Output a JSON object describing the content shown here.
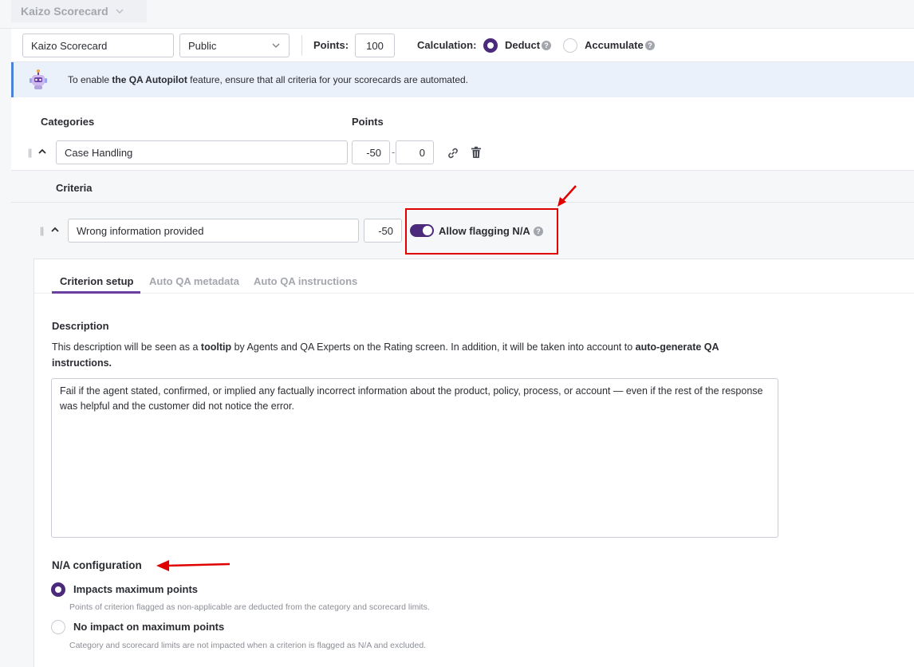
{
  "breadcrumb": {
    "title": "Kaizo Scorecard"
  },
  "settings": {
    "name_value": "Kaizo Scorecard",
    "visibility_value": "Public",
    "points_label": "Points:",
    "points_value": "100",
    "calculation_label": "Calculation:",
    "deduct_label": "Deduct",
    "accumulate_label": "Accumulate",
    "selected_calculation": "Deduct"
  },
  "banner": {
    "text_prefix": "To enable ",
    "text_bold": "the QA Autopilot",
    "text_suffix": " feature, ensure that all criteria for your scorecards are automated."
  },
  "categories": {
    "header_label": "Categories",
    "points_header_label": "Points",
    "items": [
      {
        "name": "Case Handling",
        "min": "-50",
        "separator": "-",
        "max": "0"
      }
    ]
  },
  "criteria": {
    "header_label": "Criteria",
    "items": [
      {
        "name": "Wrong information provided",
        "points": "-50",
        "toggle_label": "Allow flagging N/A",
        "toggle_on": true
      }
    ]
  },
  "tabs": [
    {
      "label": "Criterion setup",
      "active": true
    },
    {
      "label": "Auto QA metadata",
      "active": false
    },
    {
      "label": "Auto QA instructions",
      "active": false
    }
  ],
  "description": {
    "title": "Description",
    "help_part1": "This description will be seen as a ",
    "help_bold1": "tooltip",
    "help_part2": " by Agents and QA Experts on the Rating screen. In addition, it will be taken into account to ",
    "help_bold2": "auto-generate QA instructions.",
    "value": "Fail if the agent stated, confirmed, or implied any factually incorrect information about the product, policy, process, or account — even if the rest of the response was helpful and the customer did not notice the error."
  },
  "na_config": {
    "title": "N/A configuration",
    "options": [
      {
        "label": "Impacts maximum points",
        "help": "Points of criterion flagged as non-applicable are deducted from the category and scorecard limits.",
        "selected": true
      },
      {
        "label": "No impact on maximum points",
        "help": "Category and scorecard limits are not impacted when a criterion is flagged as N/A and excluded.",
        "selected": false
      }
    ]
  },
  "colors": {
    "accent": "#4b2a7b",
    "annotation_red": "#e00000",
    "banner_bg": "#eaf1fb"
  },
  "icons": [
    "chevron-down-icon",
    "robot-icon",
    "drag-handle-icon",
    "chevron-up-icon",
    "link-icon",
    "trash-icon",
    "help-icon"
  ]
}
